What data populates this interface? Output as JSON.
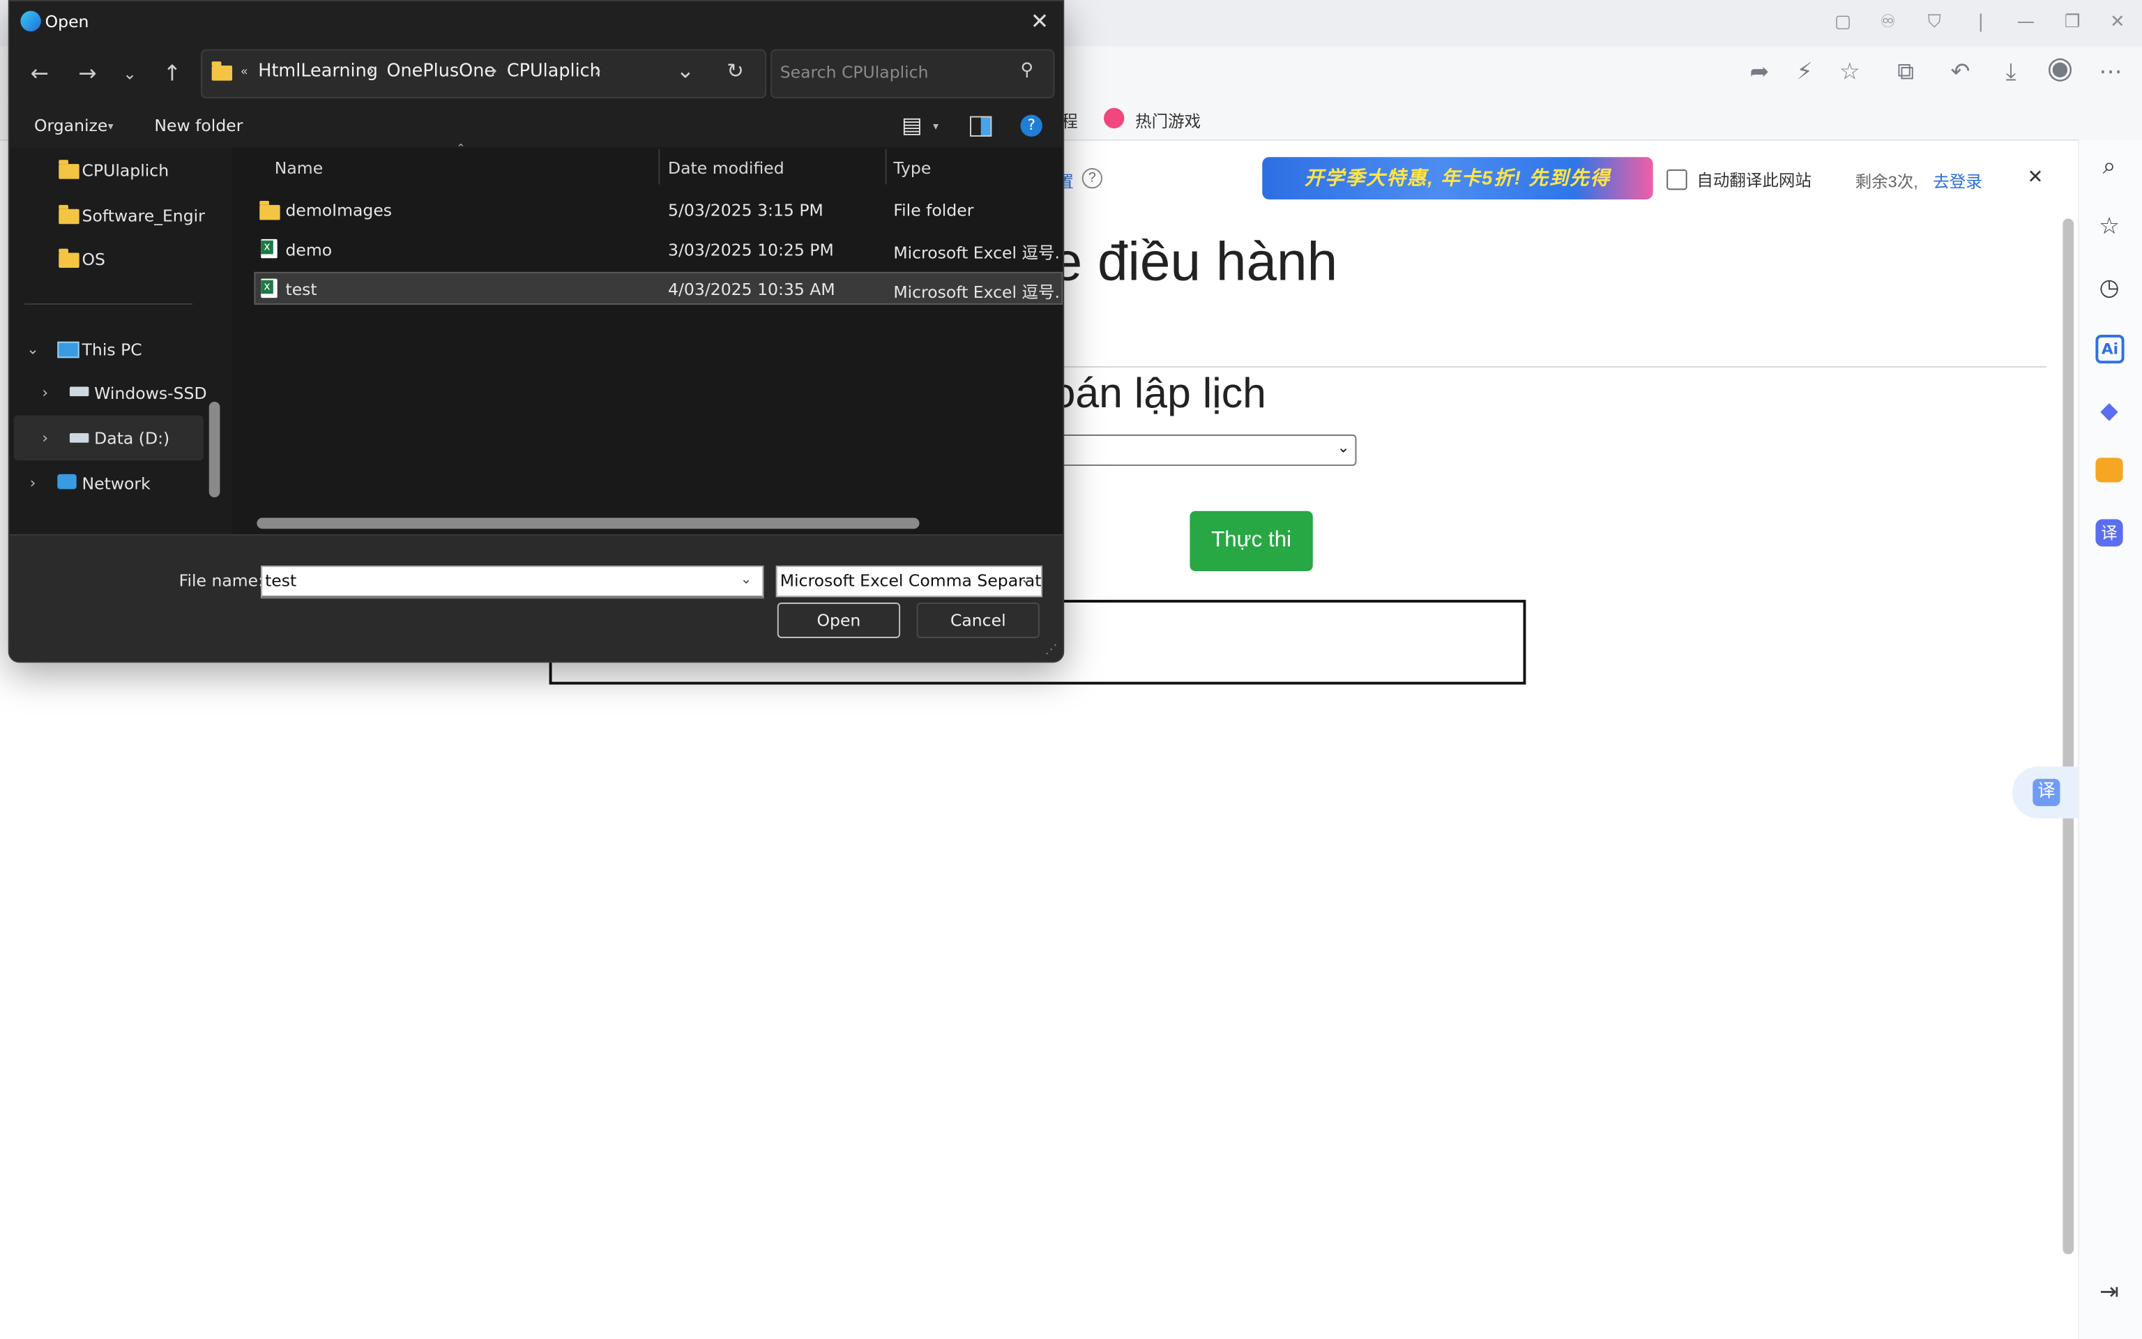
{
  "browser": {
    "favorites": [
      {
        "label": "程"
      },
      {
        "label": "热门游戏"
      }
    ],
    "translate_bar": {
      "left_text": "置",
      "help": "?",
      "banner": "开学季大特惠, 年卡5折! 先到先得",
      "checkbox_label": "自动翻译此网站",
      "remaining": "剩余3次,",
      "login": "去登录",
      "close": "✕"
    },
    "right_sidebar": [
      "search-icon",
      "star-icon",
      "history-icon",
      "ai-icon",
      "game-icon",
      "toolbox-icon",
      "translate-icon",
      "collapse-icon"
    ],
    "ai_label": "Ai",
    "translate_glyph": "译",
    "float_translate": "译"
  },
  "page": {
    "heading": "e điều hành",
    "subheading": "oán lập lịch",
    "run_button": "Thực thi"
  },
  "dialog": {
    "title": "Open",
    "breadcrumb": [
      "HtmlLearning",
      "OnePlusOne",
      "CPUlaplich"
    ],
    "search_placeholder": "Search CPUlaplich",
    "commands": {
      "organize": "Organize",
      "new_folder": "New folder"
    },
    "nav_pane": {
      "folders": [
        "CPUlaplich",
        "Software_Engine",
        "OS"
      ],
      "this_pc": "This PC",
      "drives": [
        "Windows-SSD",
        "Data (D:)"
      ],
      "network": "Network"
    },
    "columns": {
      "name": "Name",
      "date": "Date modified",
      "type": "Type"
    },
    "files": [
      {
        "name": "demoImages",
        "date": "5/03/2025 3:15 PM",
        "type": "File folder",
        "kind": "folder"
      },
      {
        "name": "demo",
        "date": "3/03/2025 10:25 PM",
        "type": "Microsoft Excel 逗号...",
        "kind": "excel"
      },
      {
        "name": "test",
        "date": "4/03/2025 10:35 AM",
        "type": "Microsoft Excel 逗号...",
        "kind": "excel",
        "selected": true
      }
    ],
    "file_name_label": "File name:",
    "file_name_value": "test",
    "file_type": "Microsoft Excel Comma Separat",
    "open_button": "Open",
    "cancel_button": "Cancel"
  }
}
